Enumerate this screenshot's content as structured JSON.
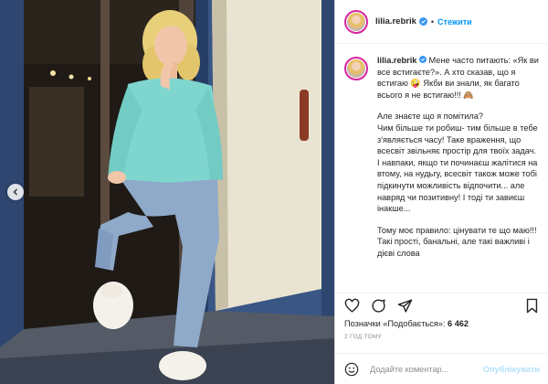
{
  "post": {
    "username": "lilia.rebrik",
    "follow_label": "Стежити",
    "dot": "•",
    "caption": {
      "username": "lilia.rebrik",
      "first": "Мене часто питають: «Як ви все встигаєте?». А хто сказав, що я встигаю 🤪 Якби ви знали, як багато всього я не встигаю!!! 🙈",
      "second": "Але знаєте що я помітила?\nЧим більше ти робиш- тим більше в тебе з'являється часу! Таке враження, що всесвіт звільняє простір для твоїх задач.\nІ навпаки, якщо ти починаєш жалітися на втому, на нудьгу, всесвіт також може тобі підкинути можливість відпочити... але навряд чи позитивну! І тоді ти завиєш інакше...",
      "third": "Тому моє правило: цінувати те що маю!!! Такі прості, банальні, але такі важливі і дієві слова"
    },
    "likes_label": "Позначки «Подобається»:",
    "likes_count": "6 462",
    "time_ago": "2 ГОД ТОМУ",
    "comment_placeholder": "Додайте коментар...",
    "publish_label": "Опублікувати"
  },
  "icons": {
    "verified": "verified-badge-icon",
    "heart": "heart-icon",
    "comment": "comment-icon",
    "share": "share-icon",
    "save": "bookmark-icon",
    "emoji": "emoji-icon",
    "prev": "chevron-left-icon"
  },
  "colors": {
    "accent": "#0095f6",
    "publish_disabled": "#b2dffc",
    "sweater": "#7fd6cf",
    "jeans": "#8fa9c9"
  }
}
